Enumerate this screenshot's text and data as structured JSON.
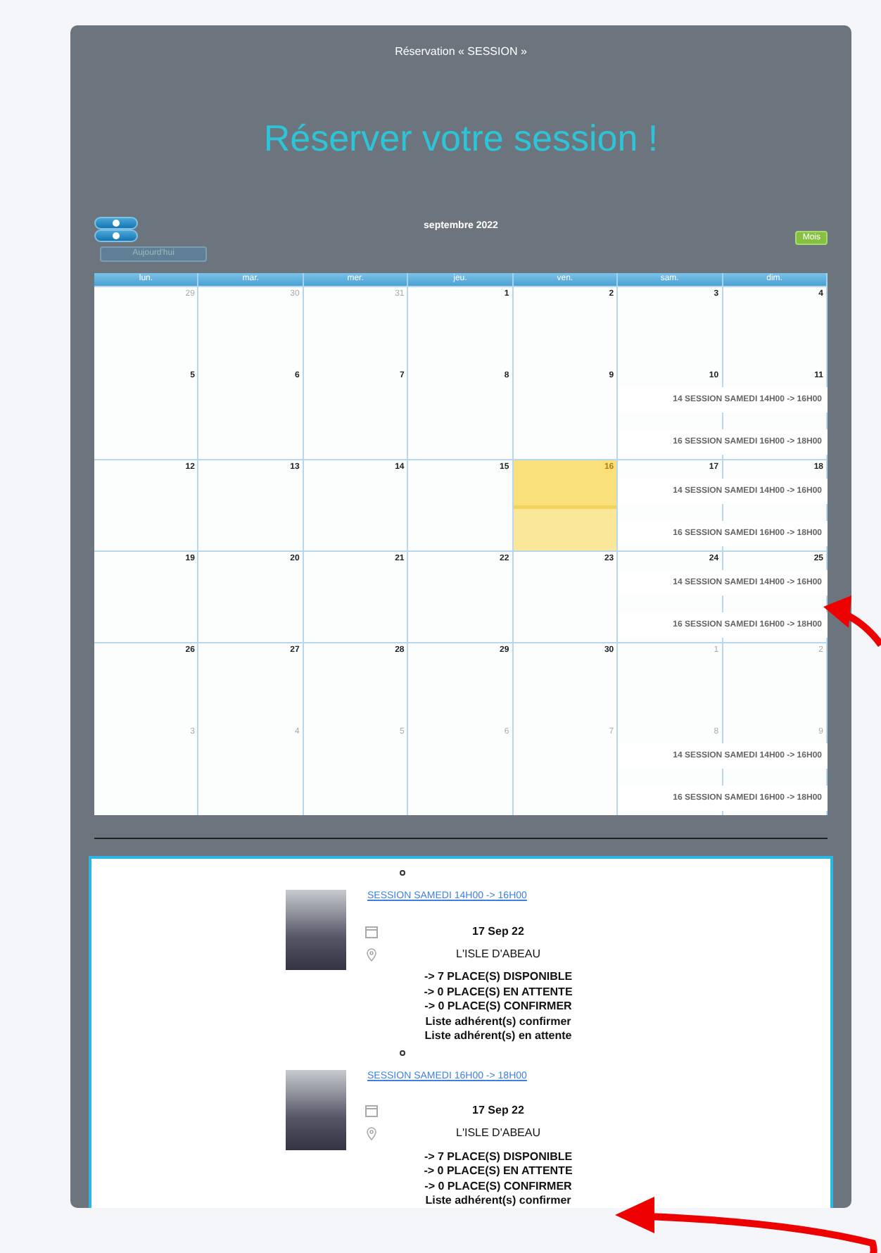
{
  "page_title": "Réservation « SESSION »",
  "heading": "Réserver votre session !",
  "calendar": {
    "title": "septembre 2022",
    "today_button": "Aujourd'hui",
    "view_button": "Mois",
    "weekdays": [
      "lun.",
      "mar.",
      "mer.",
      "jeu.",
      "ven.",
      "sam.",
      "dim."
    ],
    "weeks": [
      {
        "days": [
          {
            "label": "29",
            "other_month": true,
            "today": false
          },
          {
            "label": "30",
            "other_month": true,
            "today": false
          },
          {
            "label": "31",
            "other_month": true,
            "today": false
          },
          {
            "label": "1",
            "other_month": false,
            "today": false
          },
          {
            "label": "2",
            "other_month": false,
            "today": false
          },
          {
            "label": "3",
            "other_month": false,
            "today": false
          },
          {
            "label": "4",
            "other_month": false,
            "today": false
          }
        ]
      },
      {
        "days": [
          {
            "label": "5",
            "other_month": false,
            "today": false
          },
          {
            "label": "6",
            "other_month": false,
            "today": false
          },
          {
            "label": "7",
            "other_month": false,
            "today": false
          },
          {
            "label": "8",
            "other_month": false,
            "today": false
          },
          {
            "label": "9",
            "other_month": false,
            "today": false
          },
          {
            "label": "10",
            "other_month": false,
            "today": false
          },
          {
            "label": "11",
            "other_month": false,
            "today": false
          }
        ],
        "events": [
          "14 SESSION SAMEDI 14H00 -> 16H00",
          "16 SESSION SAMEDI 16H00 -> 18H00"
        ]
      },
      {
        "days": [
          {
            "label": "12",
            "other_month": false,
            "today": false
          },
          {
            "label": "13",
            "other_month": false,
            "today": false
          },
          {
            "label": "14",
            "other_month": false,
            "today": false
          },
          {
            "label": "15",
            "other_month": false,
            "today": false
          },
          {
            "label": "16",
            "other_month": false,
            "today": true
          },
          {
            "label": "17",
            "other_month": false,
            "today": false
          },
          {
            "label": "18",
            "other_month": false,
            "today": false
          }
        ],
        "events": [
          "14 SESSION SAMEDI 14H00 -> 16H00",
          "16 SESSION SAMEDI 16H00 -> 18H00"
        ]
      },
      {
        "days": [
          {
            "label": "19",
            "other_month": false,
            "today": false
          },
          {
            "label": "20",
            "other_month": false,
            "today": false
          },
          {
            "label": "21",
            "other_month": false,
            "today": false
          },
          {
            "label": "22",
            "other_month": false,
            "today": false
          },
          {
            "label": "23",
            "other_month": false,
            "today": false
          },
          {
            "label": "24",
            "other_month": false,
            "today": false
          },
          {
            "label": "25",
            "other_month": false,
            "today": false
          }
        ],
        "events": [
          "14 SESSION SAMEDI 14H00 -> 16H00",
          "16 SESSION SAMEDI 16H00 -> 18H00"
        ]
      },
      {
        "days": [
          {
            "label": "26",
            "other_month": false,
            "today": false
          },
          {
            "label": "27",
            "other_month": false,
            "today": false
          },
          {
            "label": "28",
            "other_month": false,
            "today": false
          },
          {
            "label": "29",
            "other_month": false,
            "today": false
          },
          {
            "label": "30",
            "other_month": false,
            "today": false
          },
          {
            "label": "1",
            "other_month": true,
            "today": false
          },
          {
            "label": "2",
            "other_month": true,
            "today": false
          }
        ]
      },
      {
        "days": [
          {
            "label": "3",
            "other_month": true,
            "today": false
          },
          {
            "label": "4",
            "other_month": true,
            "today": false
          },
          {
            "label": "5",
            "other_month": true,
            "today": false
          },
          {
            "label": "6",
            "other_month": true,
            "today": false
          },
          {
            "label": "7",
            "other_month": true,
            "today": false
          },
          {
            "label": "8",
            "other_month": true,
            "today": false
          },
          {
            "label": "9",
            "other_month": true,
            "today": false
          }
        ],
        "events": [
          "14 SESSION SAMEDI 14H00 -> 16H00",
          "16 SESSION SAMEDI 16H00 -> 18H00"
        ]
      }
    ]
  },
  "sessions": [
    {
      "title": "SESSION SAMEDI 14H00 -> 16H00",
      "date": "17 Sep 22",
      "location": "L'ISLE D'ABEAU",
      "lines": [
        "-> 7 PLACE(S) DISPONIBLE",
        "-> 0 PLACE(S) EN ATTENTE",
        "-> 0 PLACE(S) CONFIRMER",
        "Liste adhérent(s) confirmer",
        "Liste adhérent(s) en attente"
      ]
    },
    {
      "title": "SESSION SAMEDI 16H00 -> 18H00",
      "date": "17 Sep 22",
      "location": "L'ISLE D'ABEAU",
      "lines": [
        "-> 7 PLACE(S) DISPONIBLE",
        "-> 0 PLACE(S) EN ATTENTE",
        "-> 0 PLACE(S) CONFIRMER",
        "Liste adhérent(s) confirmer"
      ]
    }
  ]
}
